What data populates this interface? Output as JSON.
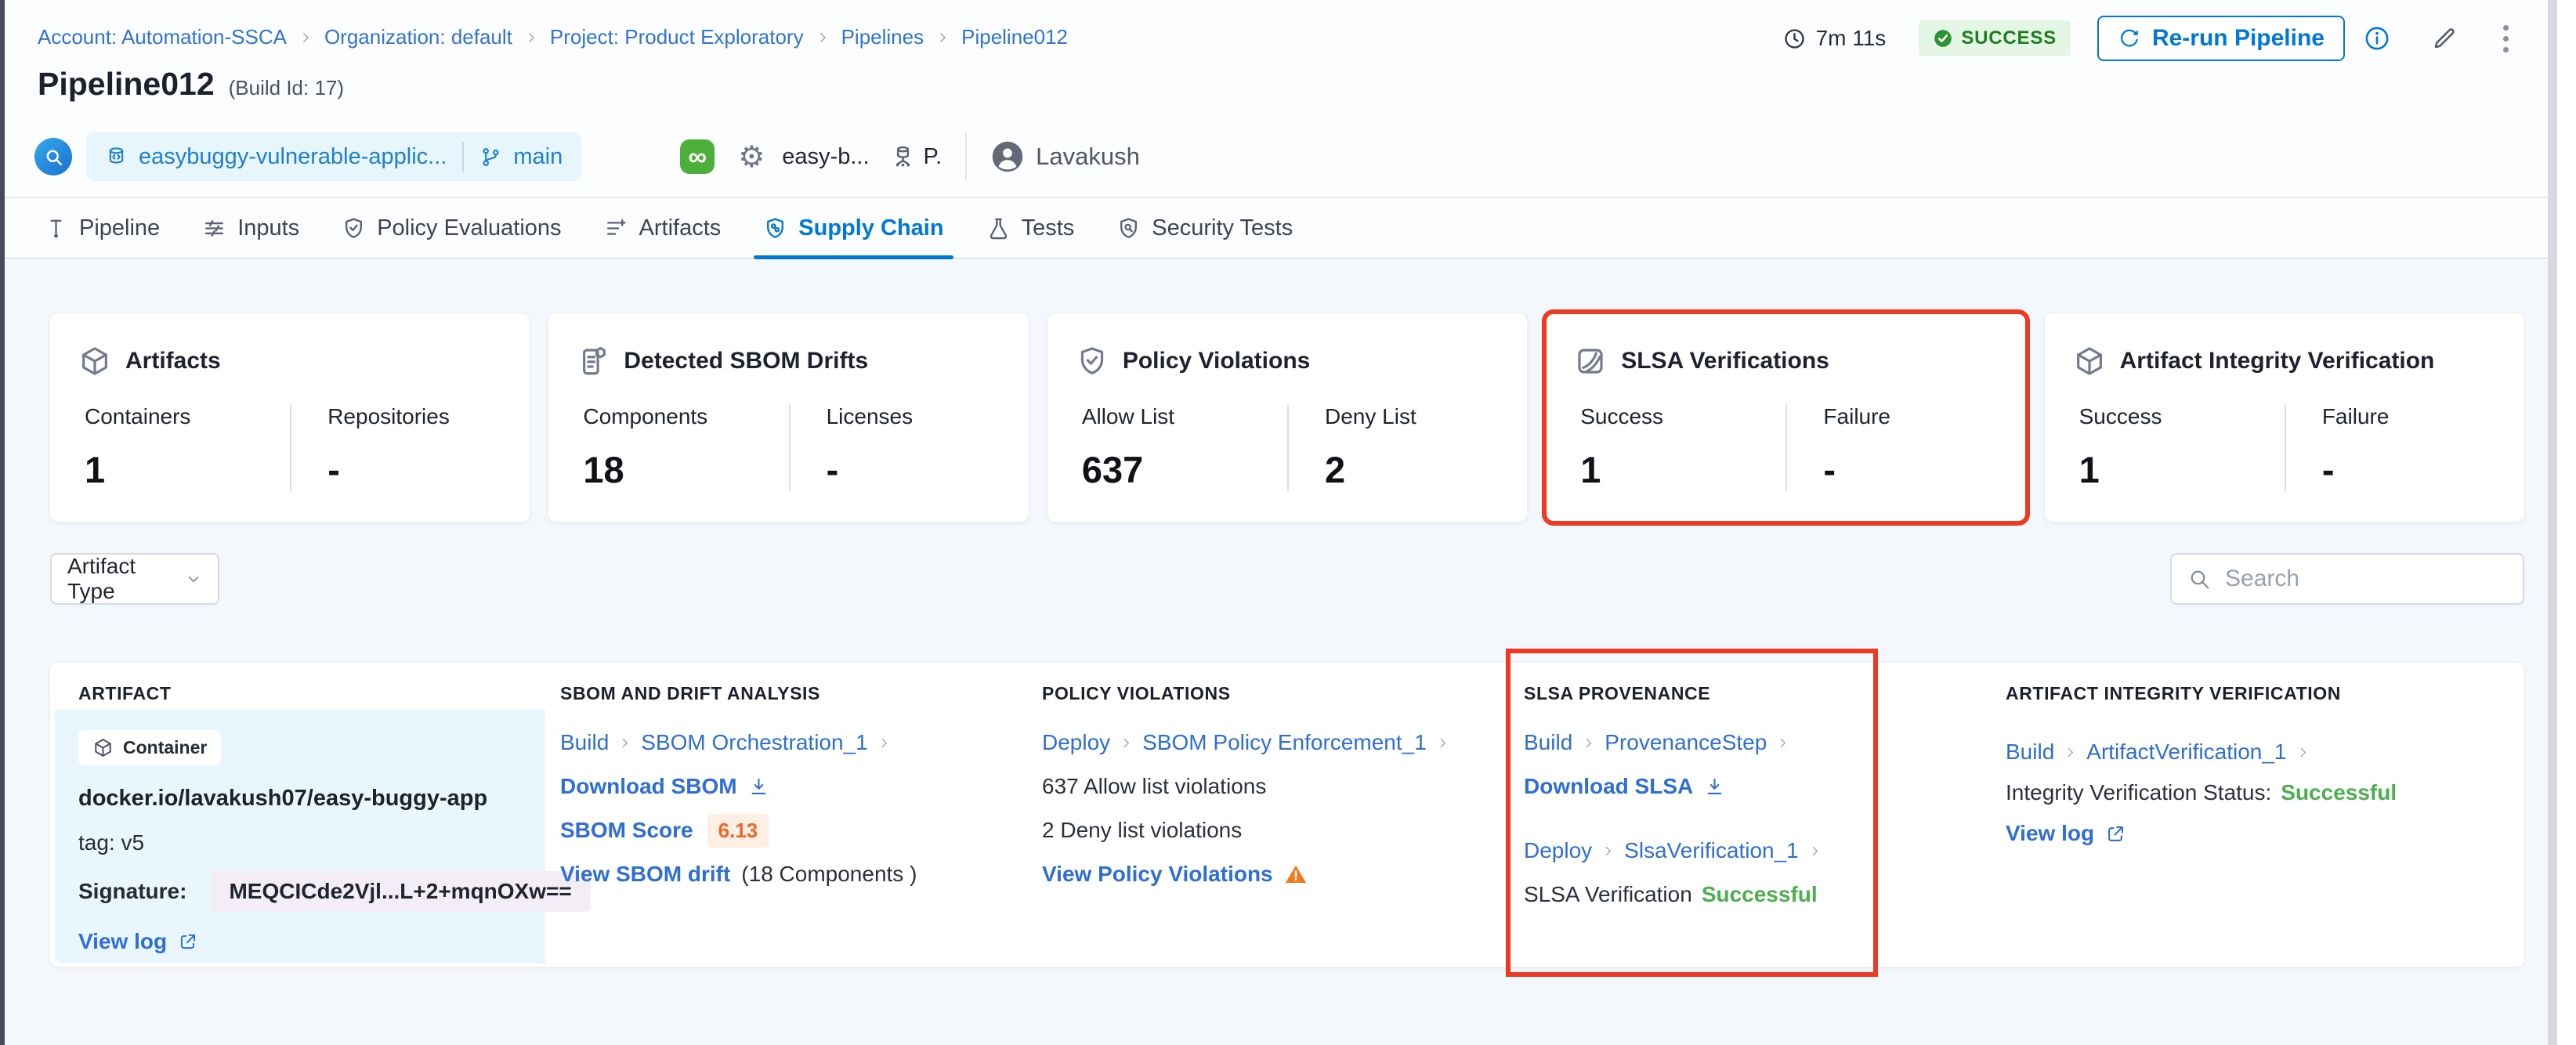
{
  "colors": {
    "accent": "#0278d5",
    "link": "#2f6fd4",
    "success": "#4caf4f",
    "warning": "#f2791f",
    "annotation_red": "#ee3a23",
    "success_badge_bg": "#e4f6e4",
    "success_badge_text": "#1e7d1e",
    "artifact_cell_bg": "#e9f6fd"
  },
  "glyphs": {
    "infinity": "∞",
    "gear": "⚙"
  },
  "breadcrumb": {
    "items": [
      "Account: Automation-SSCA",
      "Organization: default",
      "Project: Product Exploratory",
      "Pipelines",
      "Pipeline012"
    ]
  },
  "run_header": {
    "duration": "7m 11s",
    "status_badge": "SUCCESS",
    "rerun_button": "Re-run Pipeline",
    "title": "Pipeline012",
    "build_id": "(Build Id: 17)",
    "repo_name": "easybuggy-vulnerable-applic...",
    "branch": "main",
    "pipeline_ref": "easy-b...",
    "trigger_ref": "P.",
    "user_name": "Lavakush"
  },
  "tabs": [
    {
      "label": "Pipeline",
      "icon": "pipeline-icon",
      "active": false
    },
    {
      "label": "Inputs",
      "icon": "inputs-icon",
      "active": false
    },
    {
      "label": "Policy Evaluations",
      "icon": "shield-check-icon",
      "active": false
    },
    {
      "label": "Artifacts",
      "icon": "artifacts-icon",
      "active": false
    },
    {
      "label": "Supply Chain",
      "icon": "supply-chain-shield-icon",
      "active": true
    },
    {
      "label": "Tests",
      "icon": "flask-icon",
      "active": false
    },
    {
      "label": "Security Tests",
      "icon": "security-shield-icon",
      "active": false
    }
  ],
  "summary_cards": [
    {
      "title": "Artifacts",
      "icon": "cube-icon",
      "highlighted": false,
      "stats": [
        {
          "label": "Containers",
          "value": "1"
        },
        {
          "label": "Repositories",
          "value": "-"
        }
      ]
    },
    {
      "title": "Detected SBOM Drifts",
      "icon": "sbom-scroll-icon",
      "highlighted": false,
      "stats": [
        {
          "label": "Components",
          "value": "18"
        },
        {
          "label": "Licenses",
          "value": "-"
        }
      ]
    },
    {
      "title": "Policy Violations",
      "icon": "shield-check-icon",
      "highlighted": false,
      "stats": [
        {
          "label": "Allow List",
          "value": "637"
        },
        {
          "label": "Deny List",
          "value": "2"
        }
      ]
    },
    {
      "title": "SLSA Verifications",
      "icon": "slsa-icon",
      "highlighted": true,
      "stats": [
        {
          "label": "Success",
          "value": "1"
        },
        {
          "label": "Failure",
          "value": "-"
        }
      ]
    },
    {
      "title": "Artifact Integrity Verification",
      "icon": "cube-icon",
      "highlighted": false,
      "stats": [
        {
          "label": "Success",
          "value": "1"
        },
        {
          "label": "Failure",
          "value": "-"
        }
      ]
    }
  ],
  "filters": {
    "artifact_type": "Artifact Type",
    "search_placeholder": "Search"
  },
  "table": {
    "columns": [
      "ARTIFACT",
      "SBOM AND DRIFT ANALYSIS",
      "POLICY VIOLATIONS",
      "SLSA PROVENANCE",
      "ARTIFACT INTEGRITY VERIFICATION"
    ],
    "row": {
      "artifact": {
        "type": "Container",
        "image": "docker.io/lavakush07/easy-buggy-app",
        "tag": "tag: v5",
        "signature_label": "Signature:",
        "signature": "MEQCICde2Vjl...L+2+mqnOXw==",
        "view_log": "View log"
      },
      "sbom": {
        "stage": "Build",
        "step": "SBOM Orchestration_1",
        "download": "Download SBOM",
        "score_label": "SBOM Score",
        "score": "6.13",
        "drift_link": "View SBOM drift",
        "drift_count": "(18 Components )"
      },
      "policy": {
        "stage": "Deploy",
        "step": "SBOM Policy Enforcement_1",
        "allow": "637 Allow list violations",
        "deny": "2 Deny list violations",
        "view_link": "View Policy Violations"
      },
      "slsa": {
        "stage1": "Build",
        "step1": "ProvenanceStep",
        "download": "Download SLSA",
        "stage2": "Deploy",
        "step2": "SlsaVerification_1",
        "status_label": "SLSA Verification",
        "status": "Successful"
      },
      "integrity": {
        "stage": "Build",
        "step": "ArtifactVerification_1",
        "status_label": "Integrity Verification Status:",
        "status": "Successful",
        "view_log": "View log"
      }
    }
  }
}
